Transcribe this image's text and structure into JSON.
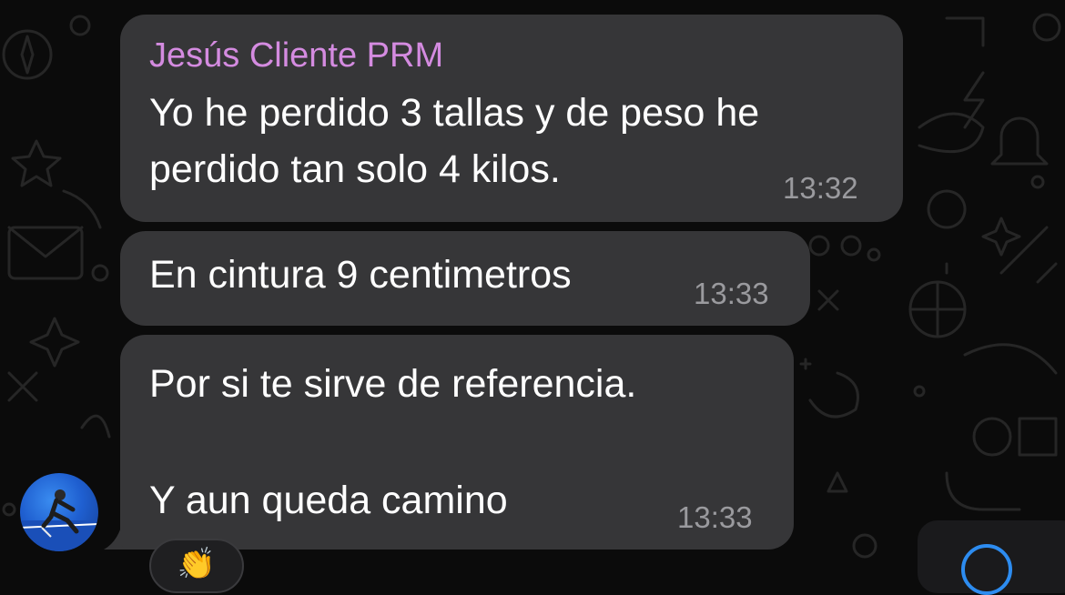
{
  "chat": {
    "messages": [
      {
        "sender": "Jesús Cliente PRM",
        "text": "Yo he perdido 3 tallas y de peso he\nperdido tan solo 4 kilos.",
        "time": "13:32"
      },
      {
        "text": "En cintura 9 centimetros",
        "time": "13:33"
      },
      {
        "text": "Por si te sirve de referencia.\n\nY aun queda camino",
        "time": "13:33",
        "reaction": "👏"
      }
    ]
  },
  "colors": {
    "background": "#0b0b0b",
    "bubble": "#363638",
    "sender_name": "#d48be0",
    "timestamp": "#9a9a9e",
    "accent": "#2d8cf0"
  },
  "icons": {
    "scroll_down": "chevron-down-circle-icon",
    "avatar": "user-avatar"
  }
}
